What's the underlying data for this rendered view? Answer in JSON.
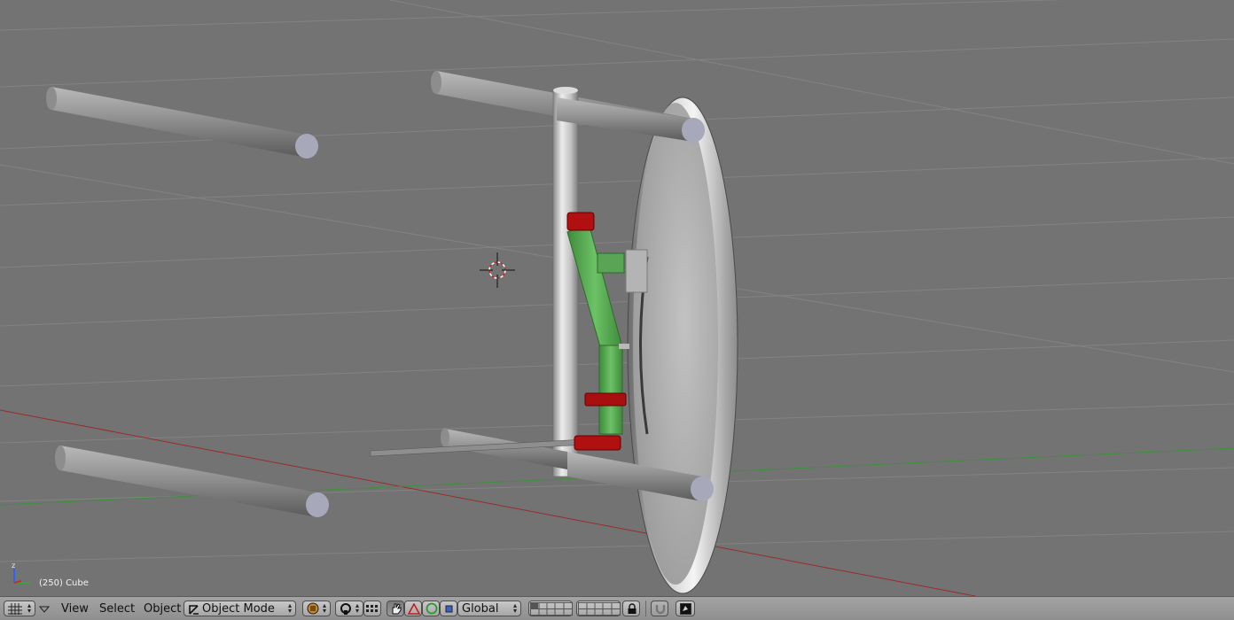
{
  "viewport": {
    "status_text": "(250) Cube",
    "axis_labels": {
      "z": "z",
      "x": "x"
    }
  },
  "header": {
    "editor_type_icon": "grid-icon",
    "menus": {
      "view": "View",
      "select": "Select",
      "object": "Object"
    },
    "mode": {
      "label": "Object Mode",
      "icon": "object-mode-icon"
    },
    "orientation": {
      "label": "Global"
    }
  },
  "colors": {
    "viewport_bg": "#737373",
    "header_bg": "#999999",
    "x_axis_line": "#9a2c2c",
    "y_axis_line": "#3f8f3f",
    "red_part": "#b01010",
    "green_part": "#5aa455"
  }
}
